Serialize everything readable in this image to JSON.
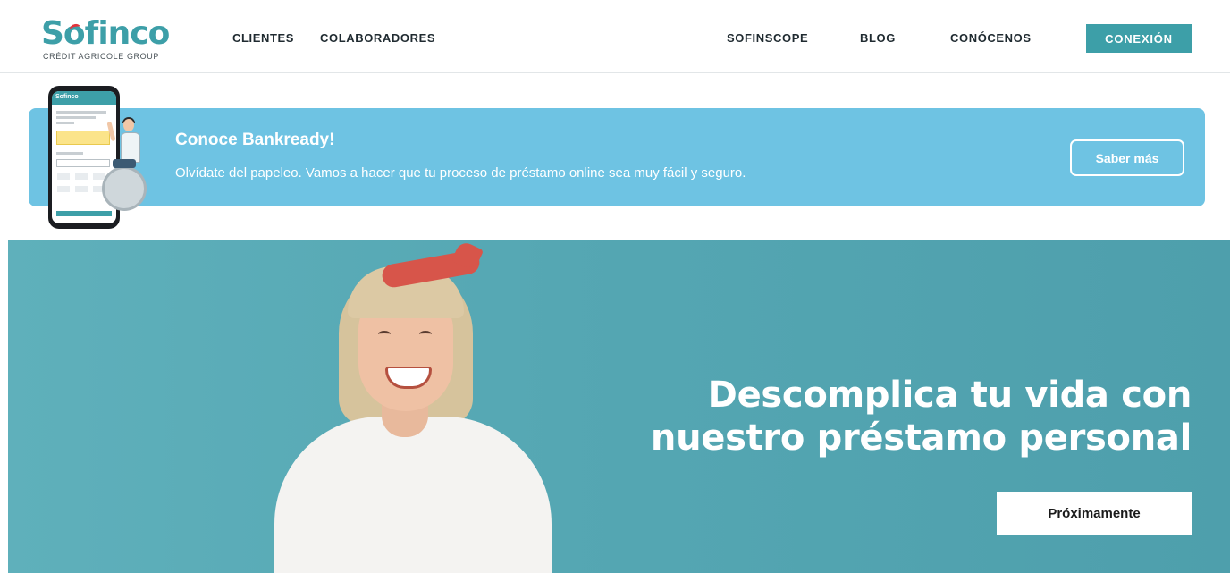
{
  "header": {
    "logo_word": "Sofinco",
    "logo_subtitle": "CRÉDIT AGRICOLE GROUP",
    "nav_left": [
      "CLIENTES",
      "COLABORADORES"
    ],
    "nav_right": [
      "SOFINSCOPE",
      "BLOG",
      "CONÓCENOS"
    ],
    "connect_button": "CONEXIÓN"
  },
  "banner": {
    "title": "Conoce Bankready!",
    "text": "Olvídate del papeleo. Vamos a hacer que tu proceso de préstamo online sea muy fácil y seguro.",
    "button": "Saber más",
    "phone_app_name": "Sofinco"
  },
  "hero": {
    "title_line1": "Descomplica tu vida con",
    "title_line2": "nuestro préstamo personal",
    "button": "Próximamente"
  },
  "colors": {
    "brand": "#3d9fa8",
    "banner": "#6ec3e3",
    "hero": "#55a7b3",
    "logo_accent": "#e2333b"
  },
  "icons": [
    "sofinco-logo",
    "phone-illustration-icon",
    "person-illustration-icon",
    "gear-icon"
  ]
}
